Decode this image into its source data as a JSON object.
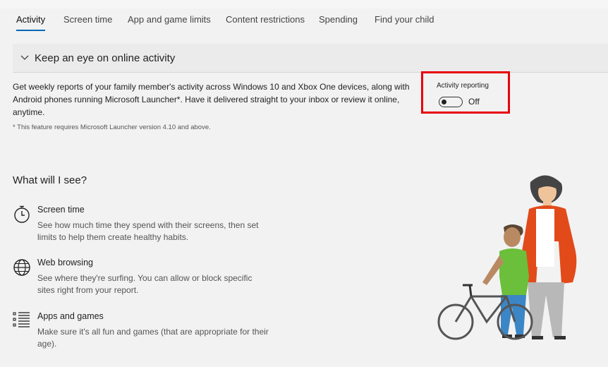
{
  "tabs": [
    {
      "label": "Activity",
      "active": true
    },
    {
      "label": "Screen time"
    },
    {
      "label": "App and game limits"
    },
    {
      "label": "Content restrictions"
    },
    {
      "label": "Spending"
    },
    {
      "label": "Find your child"
    }
  ],
  "section": {
    "title": "Keep an eye on online activity",
    "expand_icon": "chevron-down-icon",
    "description": "Get weekly reports of your family member's activity across Windows 10 and Xbox One devices, along with Android phones running Microsoft Launcher*. Have it delivered straight to your inbox or review it online, anytime.",
    "footnote": "* This feature requires Microsoft Launcher version 4.10 and above."
  },
  "activity_reporting": {
    "label": "Activity reporting",
    "state": "Off",
    "enabled": false,
    "highlight_color": "#e8000b"
  },
  "what_you_see": {
    "heading": "What will I see?",
    "features": [
      {
        "icon": "stopwatch-icon",
        "title": "Screen time",
        "description": "See how much time they spend with their screens, then set limits to help them create healthy habits."
      },
      {
        "icon": "globe-icon",
        "title": "Web browsing",
        "description": "See where they're surfing. You can allow or block specific sites right from your report."
      },
      {
        "icon": "list-icon",
        "title": "Apps and games",
        "description": "Make sure it's all fun and games (that are appropriate for their age)."
      }
    ]
  },
  "colors": {
    "accent": "#0067b8",
    "background": "#f2f2f2"
  }
}
